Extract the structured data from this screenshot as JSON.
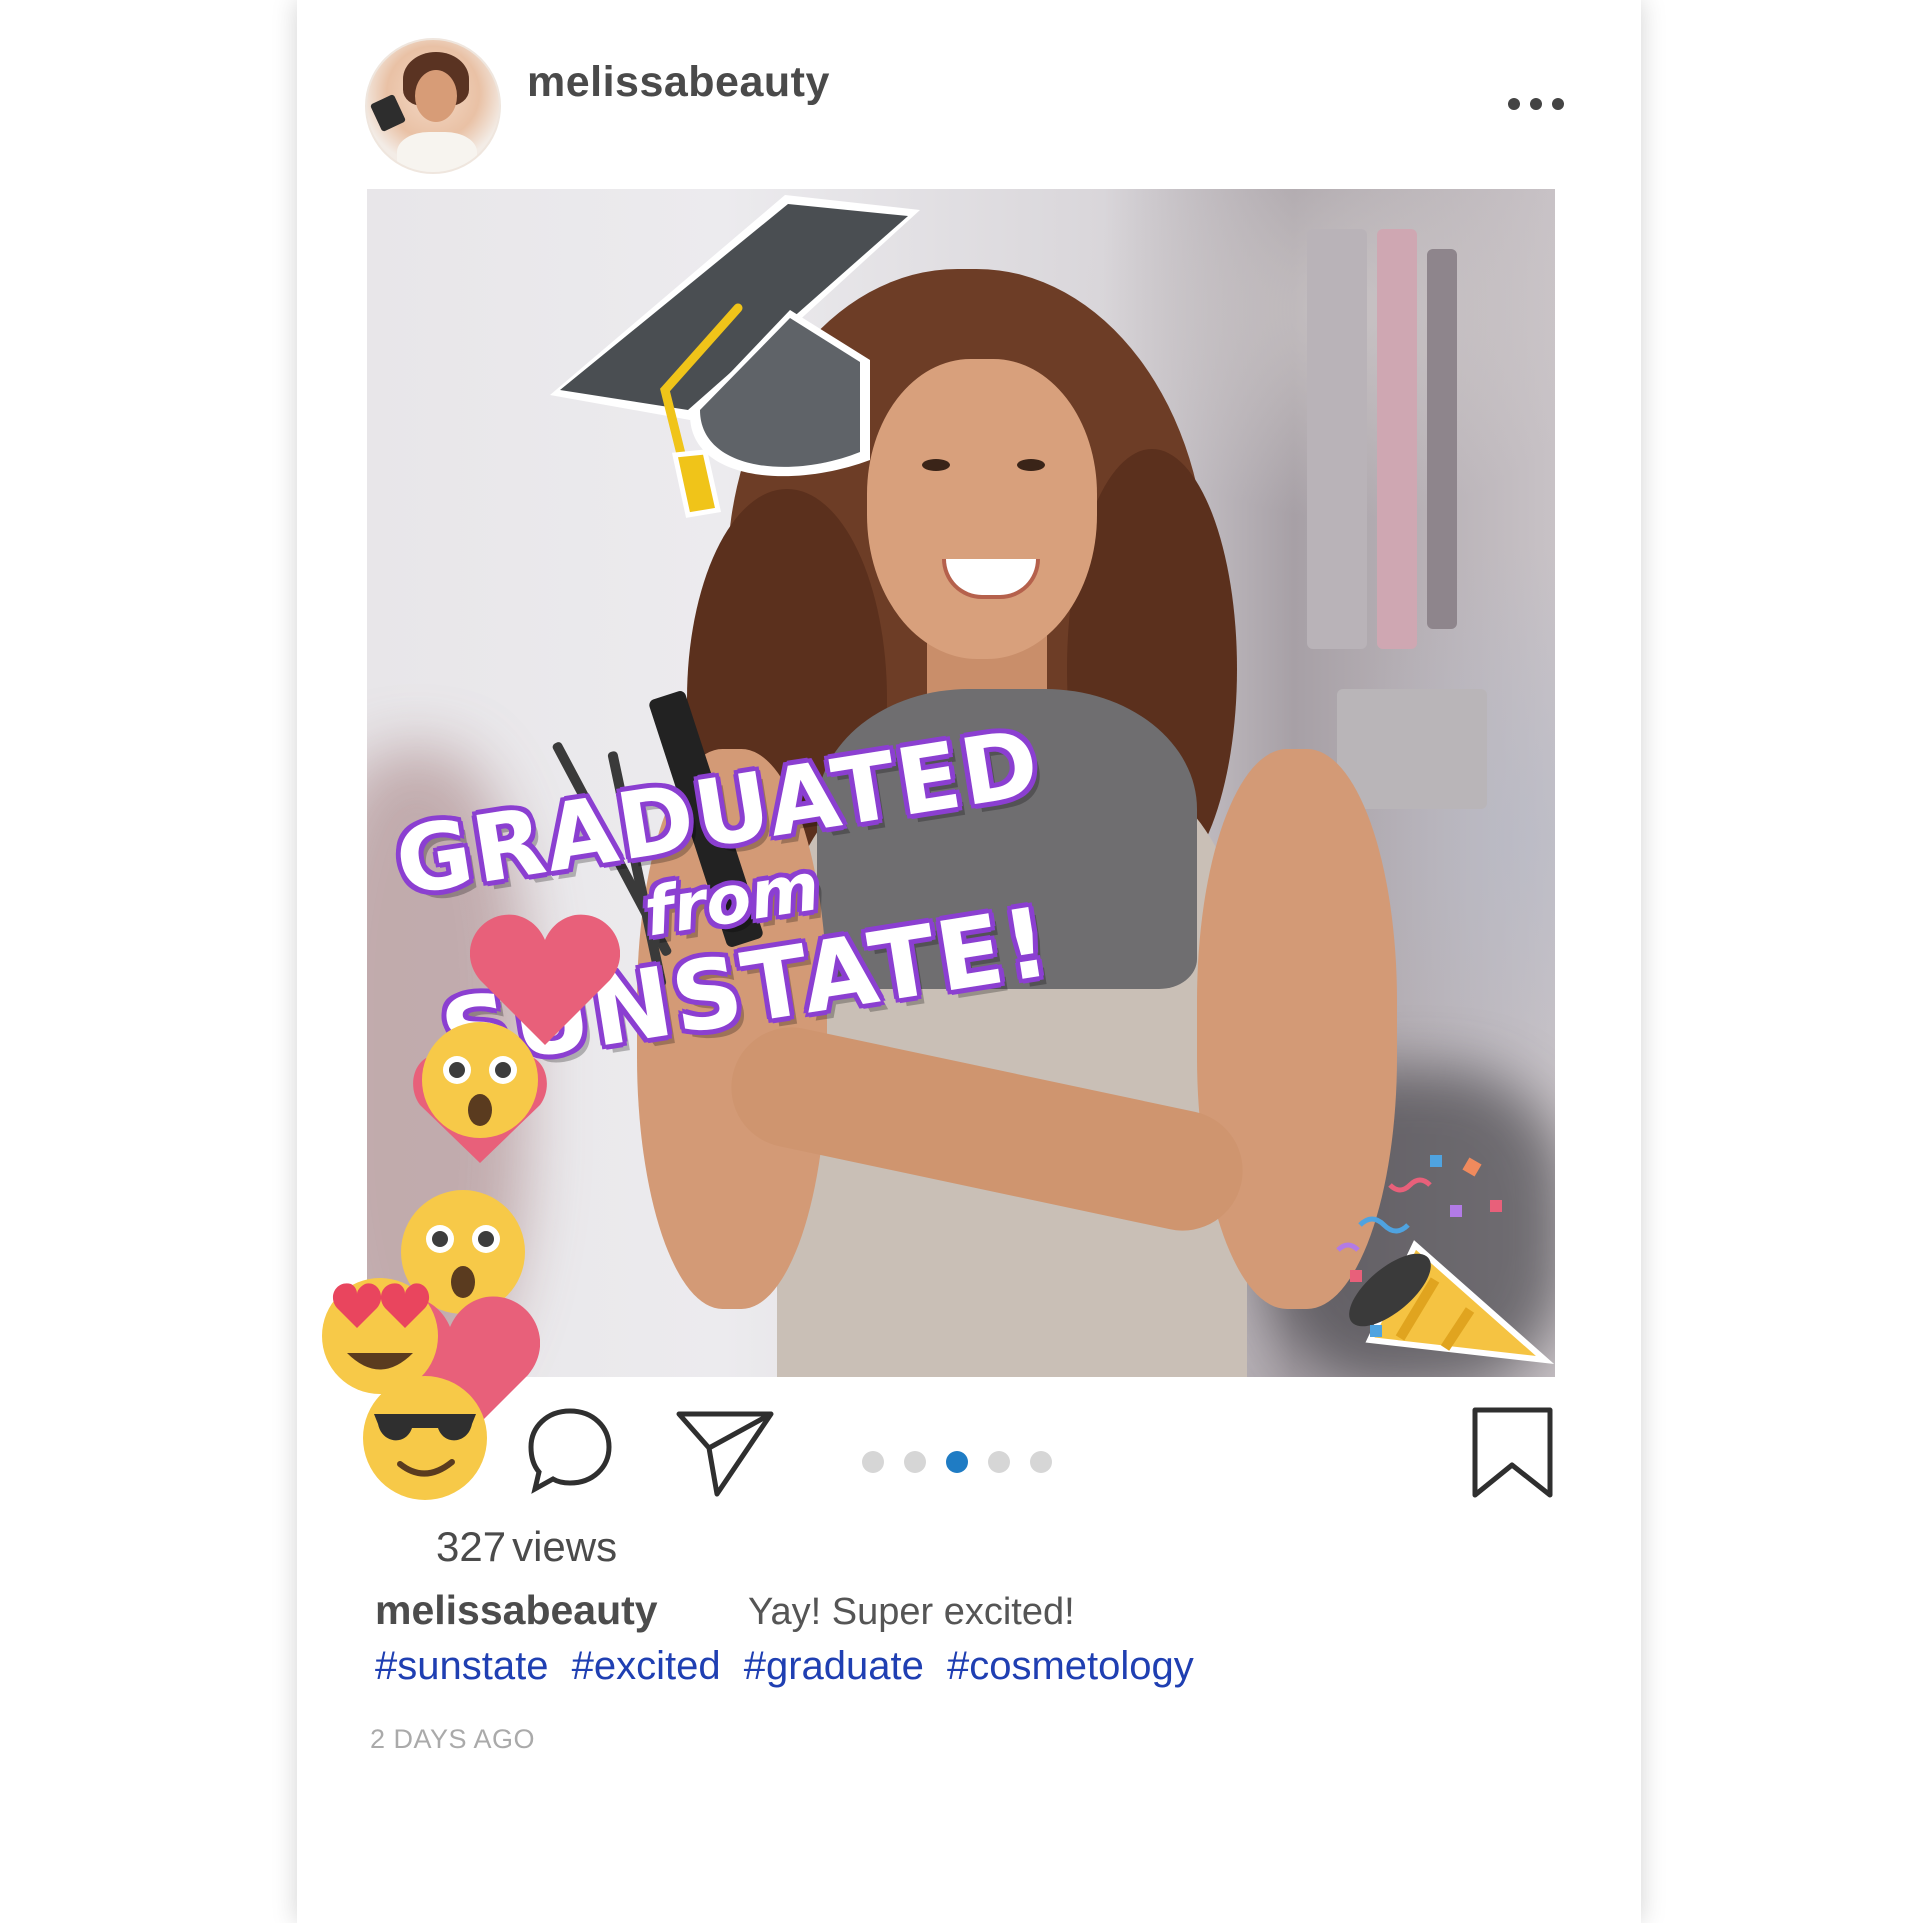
{
  "post": {
    "username": "melissabeauty",
    "headline": {
      "line1": "GRADUATED",
      "line2": "from",
      "line3": "SUNSTATE!"
    },
    "views_count": "327",
    "views_label": "views",
    "caption_user": "melissabeauty",
    "caption_text": "Yay! Super excited!",
    "hashtags": [
      "#sunstate",
      "#excited",
      "#graduate",
      "#cosmetology"
    ],
    "timestamp": "2 DAYS AGO",
    "carousel": {
      "total": 5,
      "active_index": 2
    }
  },
  "icons": {
    "more": "more-dots-icon",
    "comment": "comment-icon",
    "share": "share-icon",
    "save": "bookmark-icon",
    "graduation": "graduation-cap-icon",
    "party": "party-popper-icon",
    "reactions": [
      "heart-icon",
      "astonished-emoji-icon",
      "astonished-emoji-icon",
      "heart-eyes-emoji-icon",
      "heart-icon",
      "sunglasses-emoji-icon"
    ]
  },
  "colors": {
    "accent_purple": "#8b3fd1",
    "hashtag_blue": "#1f3fb2",
    "active_dot": "#1f7cc4",
    "inactive_dot": "#d6d6d6",
    "heart_pink": "#e8607a"
  }
}
